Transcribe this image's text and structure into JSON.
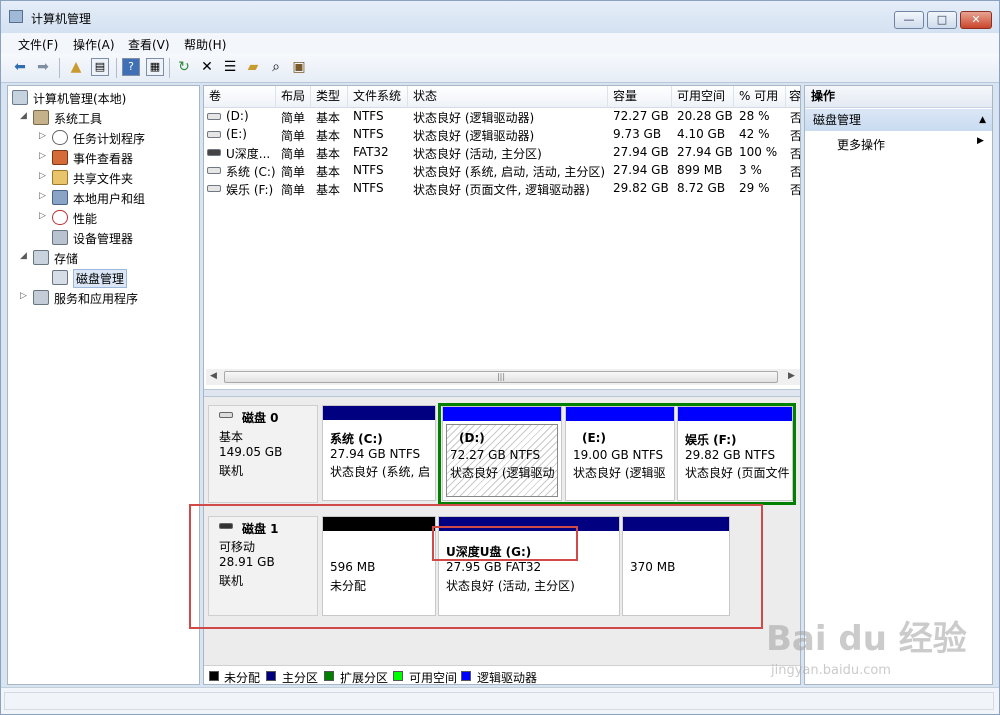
{
  "window": {
    "title": "计算机管理"
  },
  "menu": [
    "文件(F)",
    "操作(A)",
    "查看(V)",
    "帮助(H)"
  ],
  "toolbar_icons": [
    "back-arrow-icon",
    "forward-arrow-icon",
    "up-folder-icon",
    "show-tree-icon",
    "help-icon",
    "console-icon",
    "refresh-icon",
    "delete-icon",
    "properties-icon",
    "open-icon",
    "search-icon",
    "export-icon"
  ],
  "tree": {
    "root": "计算机管理(本地)",
    "items": [
      {
        "label": "系统工具"
      },
      {
        "label": "任务计划程序"
      },
      {
        "label": "事件查看器"
      },
      {
        "label": "共享文件夹"
      },
      {
        "label": "本地用户和组"
      },
      {
        "label": "性能"
      },
      {
        "label": "设备管理器"
      },
      {
        "label": "存储"
      },
      {
        "label": "磁盘管理"
      },
      {
        "label": "服务和应用程序"
      }
    ]
  },
  "volumes": {
    "headers": [
      "卷",
      "布局",
      "类型",
      "文件系统",
      "状态",
      "容量",
      "可用空间",
      "% 可用",
      "容"
    ],
    "rows": [
      {
        "vol": "(D:)",
        "layout": "简单",
        "type": "基本",
        "fs": "NTFS",
        "status": "状态良好 (逻辑驱动器)",
        "cap": "72.27 GB",
        "free": "20.28 GB",
        "pct": "28 %",
        "extra": "否"
      },
      {
        "vol": "(E:)",
        "layout": "简单",
        "type": "基本",
        "fs": "NTFS",
        "status": "状态良好 (逻辑驱动器)",
        "cap": "9.73 GB",
        "free": "4.10 GB",
        "pct": "42 %",
        "extra": "否"
      },
      {
        "vol": "U深度...",
        "layout": "简单",
        "type": "基本",
        "fs": "FAT32",
        "status": "状态良好 (活动, 主分区)",
        "cap": "27.94 GB",
        "free": "27.94 GB",
        "pct": "100 %",
        "extra": "否"
      },
      {
        "vol": "系统 (C:)",
        "layout": "简单",
        "type": "基本",
        "fs": "NTFS",
        "status": "状态良好 (系统, 启动, 活动, 主分区)",
        "cap": "27.94 GB",
        "free": "899 MB",
        "pct": "3 %",
        "extra": "否"
      },
      {
        "vol": "娱乐 (F:)",
        "layout": "简单",
        "type": "基本",
        "fs": "NTFS",
        "status": "状态良好 (页面文件, 逻辑驱动器)",
        "cap": "29.82 GB",
        "free": "8.72 GB",
        "pct": "29 %",
        "extra": "否"
      }
    ]
  },
  "disks": [
    {
      "name": "磁盘 0",
      "kind": "基本",
      "size": "149.05 GB",
      "state": "联机",
      "parts": [
        {
          "title": "系统 (C:)",
          "line1": "27.94 GB NTFS",
          "line2": "状态良好 (系统, 启"
        },
        {
          "title": "(D:)",
          "line1": "72.27 GB NTFS",
          "line2": "状态良好 (逻辑驱动"
        },
        {
          "title": "(E:)",
          "line1": "19.00 GB NTFS",
          "line2": "状态良好 (逻辑驱"
        },
        {
          "title": "娱乐 (F:)",
          "line1": "29.82 GB NTFS",
          "line2": "状态良好 (页面文件"
        }
      ]
    },
    {
      "name": "磁盘 1",
      "kind": "可移动",
      "size": "28.91 GB",
      "state": "联机",
      "parts": [
        {
          "title": "",
          "line1": "596 MB",
          "line2": "未分配"
        },
        {
          "title": "U深度U盘 (G:)",
          "line1": "27.95 GB FAT32",
          "line2": "状态良好 (活动, 主分区)"
        },
        {
          "title": "",
          "line1": "370 MB",
          "line2": ""
        }
      ]
    }
  ],
  "legend": [
    {
      "label": "未分配",
      "color": "#000000"
    },
    {
      "label": "主分区",
      "color": "#000080"
    },
    {
      "label": "扩展分区",
      "color": "#008000"
    },
    {
      "label": "可用空间",
      "color": "#00ff00"
    },
    {
      "label": "逻辑驱动器",
      "color": "#0000ff"
    }
  ],
  "colors": {
    "primary": "#000080",
    "logical": "#0000ff",
    "unallocated": "#000000",
    "extended": "#008000",
    "highlight": "#d04a4a"
  },
  "actions": {
    "header": "操作",
    "section": "磁盘管理",
    "more": "更多操作"
  },
  "watermark": {
    "line1": "Bai du 经验",
    "line2": "jingyan.baidu.com"
  }
}
